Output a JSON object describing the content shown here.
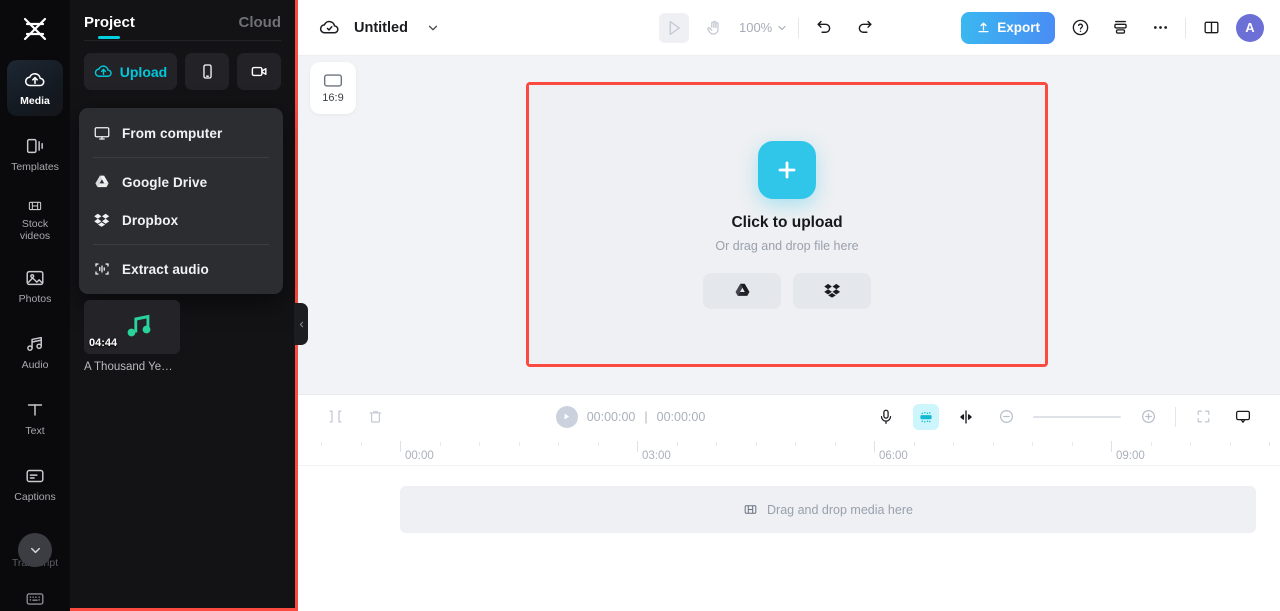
{
  "rail": {
    "logo_icon": "capcut-logo-icon",
    "items": [
      {
        "id": "media",
        "label": "Media",
        "icon": "cloud-upload-icon",
        "active": true
      },
      {
        "id": "templates",
        "label": "Templates",
        "icon": "templates-icon",
        "active": false
      },
      {
        "id": "stock",
        "label": "Stock videos",
        "icon": "film-icon",
        "active": false
      },
      {
        "id": "photos",
        "label": "Photos",
        "icon": "photo-icon",
        "active": false
      },
      {
        "id": "audio",
        "label": "Audio",
        "icon": "music-note-icon",
        "active": false
      },
      {
        "id": "text",
        "label": "Text",
        "icon": "text-t-icon",
        "active": false
      },
      {
        "id": "captions",
        "label": "Captions",
        "icon": "captions-icon",
        "active": false
      },
      {
        "id": "transcript",
        "label": "Transcript",
        "icon": "transcript-icon",
        "active": false
      }
    ],
    "expand_icon": "chevron-down-icon",
    "bottom_icon": "keyboard-icon"
  },
  "panel": {
    "tabs": [
      {
        "id": "project",
        "label": "Project",
        "active": true
      },
      {
        "id": "cloud",
        "label": "Cloud",
        "active": false
      }
    ],
    "upload_button": {
      "label": "Upload",
      "icon": "cloud-upload-icon"
    },
    "device_button": {
      "icon": "phone-icon"
    },
    "record_button": {
      "icon": "video-camera-icon"
    },
    "dropdown": {
      "items": [
        {
          "id": "from-computer",
          "label": "From computer",
          "icon": "monitor-icon"
        },
        {
          "id": "google-drive",
          "label": "Google Drive",
          "icon": "google-drive-icon"
        },
        {
          "id": "dropbox",
          "label": "Dropbox",
          "icon": "dropbox-icon"
        },
        {
          "id": "extract-audio",
          "label": "Extract audio",
          "icon": "extract-audio-icon"
        }
      ]
    },
    "media_items": [
      {
        "name": "A Thousand Ye…",
        "duration": "04:44",
        "icon": "music-note-icon"
      }
    ],
    "collapse_icon": "chevron-left-icon"
  },
  "topbar": {
    "cloud_status_icon": "cloud-check-icon",
    "title": "Untitled",
    "title_chevron_icon": "chevron-down-icon",
    "select_tool_icon": "cursor-arrow-icon",
    "hand_tool_icon": "hand-icon",
    "zoom_level": "100%",
    "zoom_chevron_icon": "chevron-down-icon",
    "undo_icon": "undo-icon",
    "redo_icon": "redo-icon",
    "export_label": "Export",
    "export_icon": "upload-arrow-icon",
    "export_color": "#3f9bf2",
    "help_icon": "question-circle-icon",
    "layers_icon": "stack-icon",
    "more_icon": "ellipsis-icon",
    "split-view_icon": "panel-split-icon",
    "avatar_initial": "A",
    "avatar_color": "#6b6fd6"
  },
  "stage": {
    "ratio_label": "16:9",
    "ratio_icon": "aspect-ratio-icon",
    "upload_title": "Click to upload",
    "upload_subtitle": "Or drag and drop file here",
    "plus_icon": "plus-icon",
    "plus_color": "#2fc6ea",
    "cloud_buttons": [
      {
        "id": "google-drive",
        "icon": "google-drive-icon"
      },
      {
        "id": "dropbox",
        "icon": "dropbox-icon"
      }
    ],
    "annotation_color": "#fb4a3f"
  },
  "timeline": {
    "split_icon": "split-clip-icon",
    "delete_icon": "trash-icon",
    "play_icon": "play-icon",
    "current_time": "00:00:00",
    "time_separator": "|",
    "total_time": "00:00:00",
    "mic_icon": "microphone-icon",
    "ai_icon": "ai-sparkle-icon",
    "mix_icon": "split-screen-icon",
    "zoom_out_icon": "minus-circle-icon",
    "zoom_in_icon": "plus-circle-icon",
    "fit_icon": "fit-screen-icon",
    "display_icon": "monitor-arrow-icon",
    "ruler_labels": [
      "00:00",
      "03:00",
      "06:00",
      "09:00"
    ],
    "ruler_positions": [
      102,
      339,
      576,
      813
    ],
    "drop_track_label": "Drag and drop media here",
    "drop_track_icon": "film-strip-icon"
  }
}
